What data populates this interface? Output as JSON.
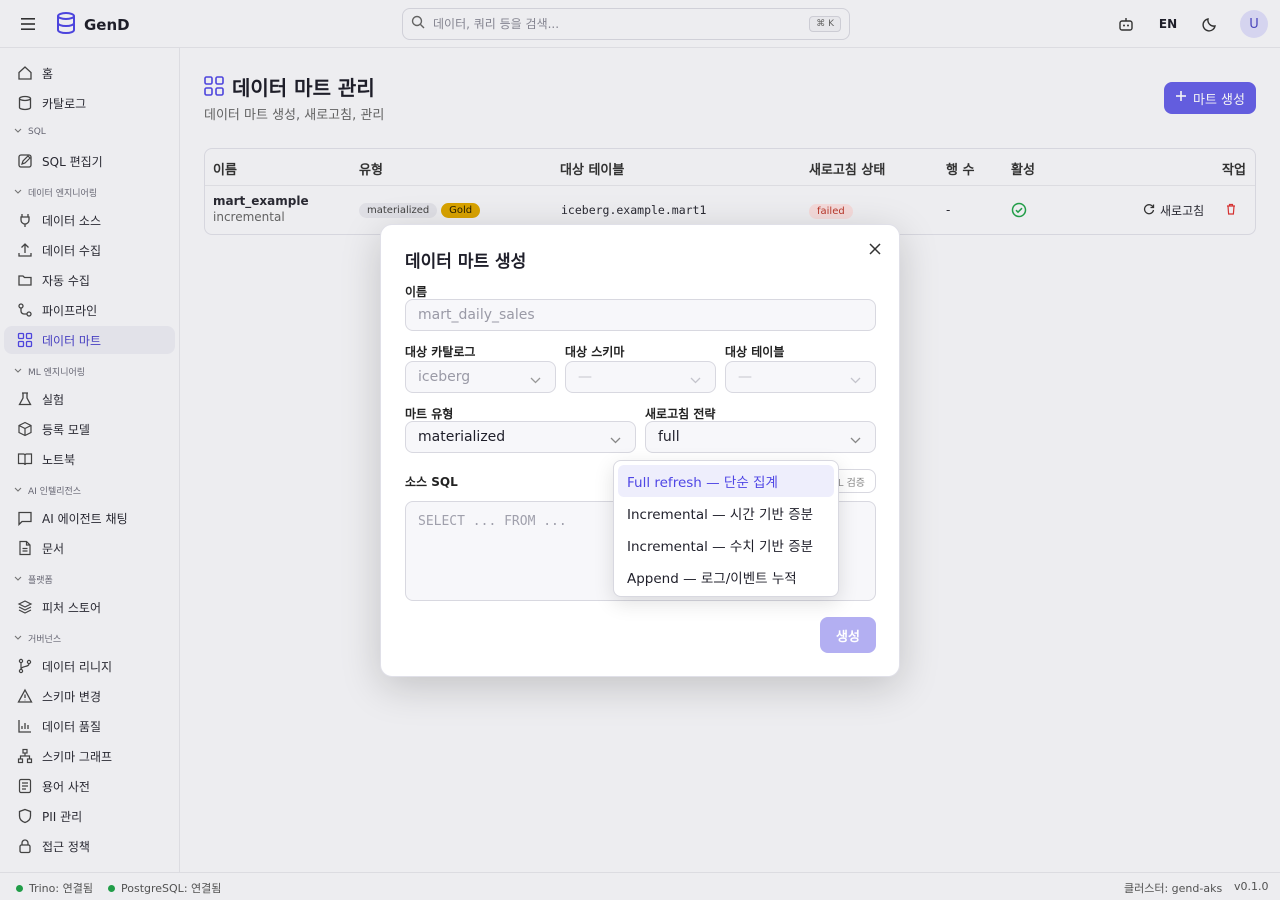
{
  "header": {
    "app_name": "GenD",
    "search_placeholder": "데이터, 쿼리 등을 검색...",
    "search_shortcut": "⌘ K",
    "lang": "EN",
    "avatar_initial": "U"
  },
  "sidebar": {
    "items_top": [
      {
        "label": "홈",
        "icon": "home-icon"
      },
      {
        "label": "카탈로그",
        "icon": "database-icon"
      }
    ],
    "sections": [
      {
        "title": "SQL",
        "items": [
          {
            "label": "SQL 편집기",
            "icon": "edit-icon"
          }
        ]
      },
      {
        "title": "데이터 엔지니어링",
        "items": [
          {
            "label": "데이터 소스",
            "icon": "plug-icon"
          },
          {
            "label": "데이터 수집",
            "icon": "upload-icon"
          },
          {
            "label": "자동 수집",
            "icon": "folder-sync-icon"
          },
          {
            "label": "파이프라인",
            "icon": "pipeline-icon"
          },
          {
            "label": "데이터 마트",
            "icon": "grid-icon"
          }
        ]
      },
      {
        "title": "ML 엔지니어링",
        "items": [
          {
            "label": "실험",
            "icon": "flask-icon"
          },
          {
            "label": "등록 모델",
            "icon": "box-icon"
          },
          {
            "label": "노트북",
            "icon": "book-icon"
          }
        ]
      },
      {
        "title": "AI 인텔리전스",
        "items": [
          {
            "label": "AI 에이전트 채팅",
            "icon": "chat-icon"
          },
          {
            "label": "문서",
            "icon": "document-icon"
          }
        ]
      },
      {
        "title": "플랫폼",
        "items": [
          {
            "label": "피처 스토어",
            "icon": "layers-icon"
          }
        ]
      },
      {
        "title": "거버넌스",
        "items": [
          {
            "label": "데이터 리니지",
            "icon": "branch-icon"
          },
          {
            "label": "스키마 변경",
            "icon": "warning-icon"
          },
          {
            "label": "데이터 품질",
            "icon": "bar-chart-icon"
          },
          {
            "label": "스키마 그래프",
            "icon": "network-icon"
          },
          {
            "label": "용어 사전",
            "icon": "list-doc-icon"
          },
          {
            "label": "PII 관리",
            "icon": "shield-icon"
          },
          {
            "label": "접근 정책",
            "icon": "lock-icon"
          }
        ]
      }
    ],
    "active": "데이터 마트"
  },
  "statusbar": {
    "trino": "Trino: 연결됨",
    "postgres": "PostgreSQL: 연결됨",
    "cluster": "클러스터: gend-aks",
    "version": "v0.1.0"
  },
  "page": {
    "title": "데이터 마트 관리",
    "subtitle": "데이터 마트 생성, 새로고침, 관리",
    "create_button": "마트 생성"
  },
  "table": {
    "headers": [
      "이름",
      "유형",
      "대상 테이블",
      "새로고침 상태",
      "행 수",
      "활성",
      "작업"
    ],
    "rows": [
      {
        "name": "mart_example",
        "strategy": "incremental",
        "type": "materialized",
        "tier": "Gold",
        "target": "iceberg.example.mart1",
        "status": "failed",
        "row_count": "-",
        "action_refresh": "새로고침"
      }
    ]
  },
  "modal": {
    "title": "데이터 마트 생성",
    "name_label": "이름",
    "name_placeholder": "mart_daily_sales",
    "catalog_label": "대상 카탈로그",
    "catalog_value": "iceberg",
    "schema_label": "대상 스키마",
    "schema_value": "—",
    "table_label": "대상 테이블",
    "table_value": "—",
    "mart_type_label": "마트 유형",
    "mart_type_value": "materialized",
    "refresh_label": "새로고침 전략",
    "refresh_value": "full",
    "sql_label": "소스 SQL",
    "sql_placeholder": "SELECT ... FROM ...",
    "validate_button": "L 검증",
    "submit_button": "생성"
  },
  "dropdown": {
    "options": [
      "Full refresh — 단순 집계",
      "Incremental — 시간 기반 증분",
      "Incremental — 수치 기반 증분",
      "Append — 로그/이벤트 누적"
    ],
    "selected_index": 0
  },
  "colors": {
    "accent": "#4f46e5",
    "gold": "#e0a800",
    "failed_bg": "#fde2e2",
    "failed_text": "#c0392b",
    "success": "#22a34a"
  }
}
